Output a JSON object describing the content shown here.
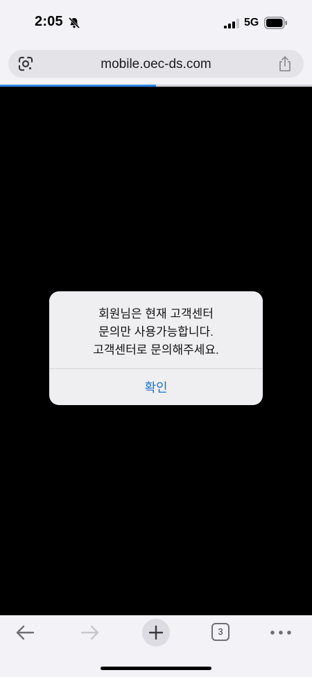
{
  "status_bar": {
    "time": "2:05",
    "network": "5G",
    "icons": [
      "bell-slash-icon",
      "signal-bars-icon",
      "battery-icon"
    ]
  },
  "browser": {
    "url": "mobile.oec-ds.com",
    "page_load_progress": 0.5,
    "tab_count": "3",
    "icons": [
      "google-lens-icon",
      "share-icon",
      "back-arrow-icon",
      "forward-arrow-icon",
      "new-tab-plus-icon",
      "tabs-icon",
      "more-menu-icon"
    ]
  },
  "alert": {
    "message_lines": [
      "회원님은 현재 고객센터",
      "문의만 사용가능합니다.",
      "고객센터로 문의해주세요."
    ],
    "confirm_label": "확인"
  },
  "colors": {
    "accent": "#1a73d1",
    "progress": "#2f86e0",
    "content_background": "#000000",
    "chrome_background": "#f2f2f7"
  }
}
